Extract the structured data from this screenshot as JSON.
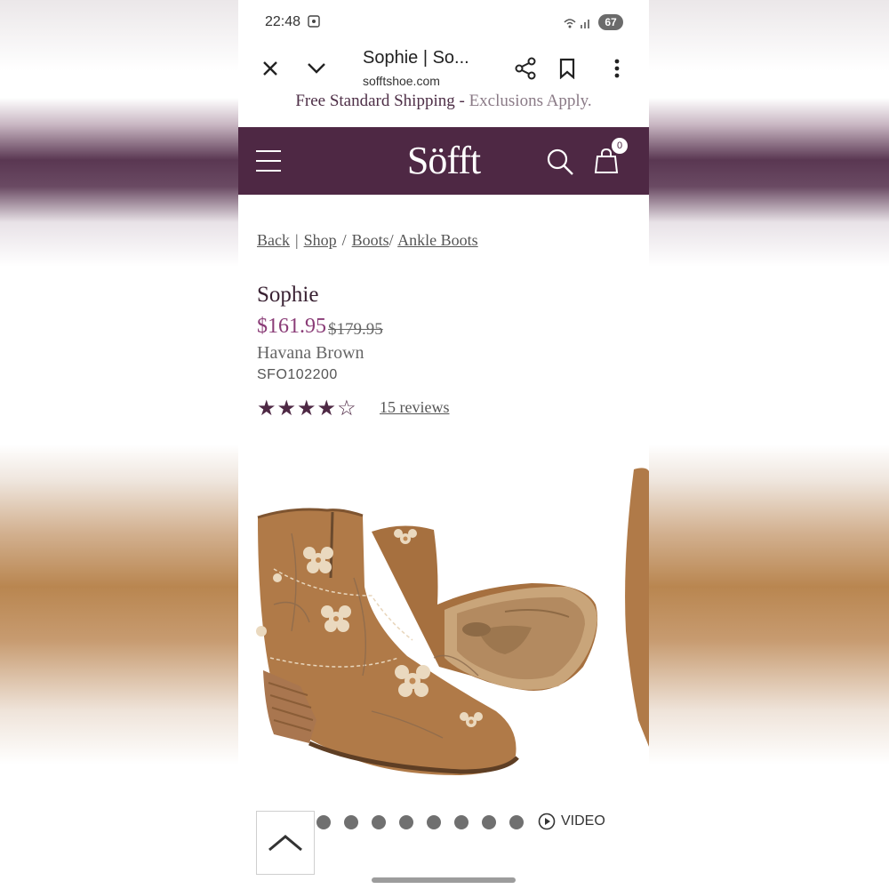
{
  "status_bar": {
    "time": "22:48",
    "battery": "67"
  },
  "browser": {
    "tab_title": "Sophie | So...",
    "url": "sofftshoe.com"
  },
  "promo": {
    "text": "Free Standard Shipping - ",
    "note": "Exclusions Apply."
  },
  "site": {
    "logo": "Söfft",
    "cart_count": "0"
  },
  "breadcrumb": {
    "back": "Back",
    "divider": "|",
    "items": [
      "Shop",
      "Boots",
      "Ankle Boots"
    ],
    "slash": "/"
  },
  "product": {
    "name": "Sophie",
    "price": "$161.95",
    "original_price": "$179.95",
    "color": "Havana Brown",
    "sku": "SFO102200",
    "rating_out_of_5": 4.5,
    "stars_display": "★★★★☆",
    "reviews": "15 reviews"
  },
  "carousel": {
    "dot_count": 8,
    "video_label": "VIDEO"
  },
  "icons": [
    "close-icon",
    "chevron-down-icon",
    "share-icon",
    "bookmark-icon",
    "more-icon",
    "menu-icon",
    "search-icon",
    "bag-icon",
    "play-icon",
    "chevron-up-icon"
  ],
  "colors": {
    "brand": "#4e2844",
    "price": "#8a3c77"
  }
}
